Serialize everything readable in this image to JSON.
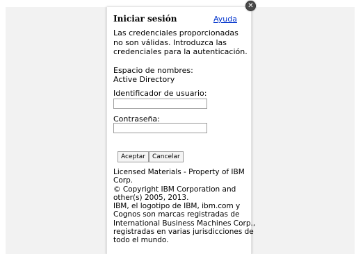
{
  "dialog": {
    "title": "Iniciar sesión",
    "help_label": "Ayuda",
    "close_glyph": "✕",
    "message": "Las credenciales proporcionadas no son válidas. Introduzca las credenciales para la autenticación.",
    "namespace_label": "Espacio de nombres:",
    "namespace_value": "Active Directory",
    "username_label": "Identificador de usuario:",
    "username_value": "",
    "password_label": "Contraseña:",
    "password_value": "",
    "ok_label": "Aceptar",
    "cancel_label": "Cancelar",
    "legal_lines": [
      "Licensed Materials - Property of IBM",
      "Corp.",
      "© Copyright IBM Corporation and",
      "other(s) 2005, 2013.",
      "IBM, el logotipo de IBM, ibm.com y",
      "Cognos son marcas registradas de",
      "International Business Machines Corp.,",
      "registradas en varias jurisdicciones de",
      "todo el mundo."
    ]
  },
  "colors": {
    "link": "#0033cc",
    "backdrop": "#f2f2f2"
  }
}
